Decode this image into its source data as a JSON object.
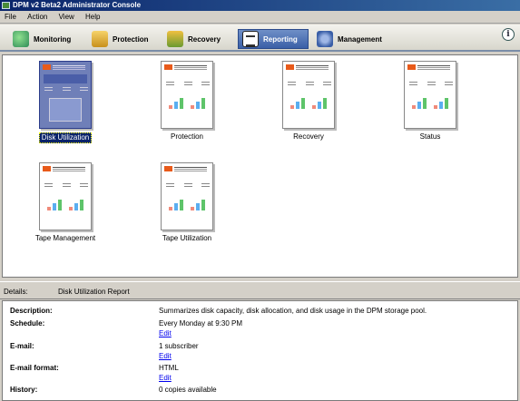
{
  "window": {
    "title": "DPM v2 Beta2 Administrator Console"
  },
  "menu": [
    "File",
    "Action",
    "View",
    "Help"
  ],
  "tabs": [
    {
      "label": "Monitoring",
      "icon": "monitoring-icon",
      "active": false
    },
    {
      "label": "Protection",
      "icon": "protection-icon",
      "active": false
    },
    {
      "label": "Recovery",
      "icon": "recovery-icon",
      "active": false
    },
    {
      "label": "Reporting",
      "icon": "reporting-icon",
      "active": true
    },
    {
      "label": "Management",
      "icon": "management-icon",
      "active": false
    }
  ],
  "reports": [
    {
      "label": "Disk Utilization",
      "selected": true
    },
    {
      "label": "Protection",
      "selected": false
    },
    {
      "label": "Recovery",
      "selected": false
    },
    {
      "label": "Status",
      "selected": false
    },
    {
      "label": "Tape Management",
      "selected": false
    },
    {
      "label": "Tape Utilization",
      "selected": false
    }
  ],
  "details": {
    "label": "Details:",
    "title": "Disk Utilization Report",
    "description_key": "Description:",
    "description": "Summarizes disk capacity, disk allocation, and disk usage in the DPM storage pool.",
    "schedule_key": "Schedule:",
    "schedule": "Every Monday at 9:30 PM",
    "edit_label": "Edit",
    "email_key": "E-mail:",
    "email": "1 subscriber",
    "email_format_key": "E-mail format:",
    "email_format": "HTML",
    "history_key": "History:",
    "history": "0 copies available"
  },
  "colors": {
    "selection": "#0a246a",
    "link": "#0000ee",
    "accent_orange": "#e85a1a"
  }
}
